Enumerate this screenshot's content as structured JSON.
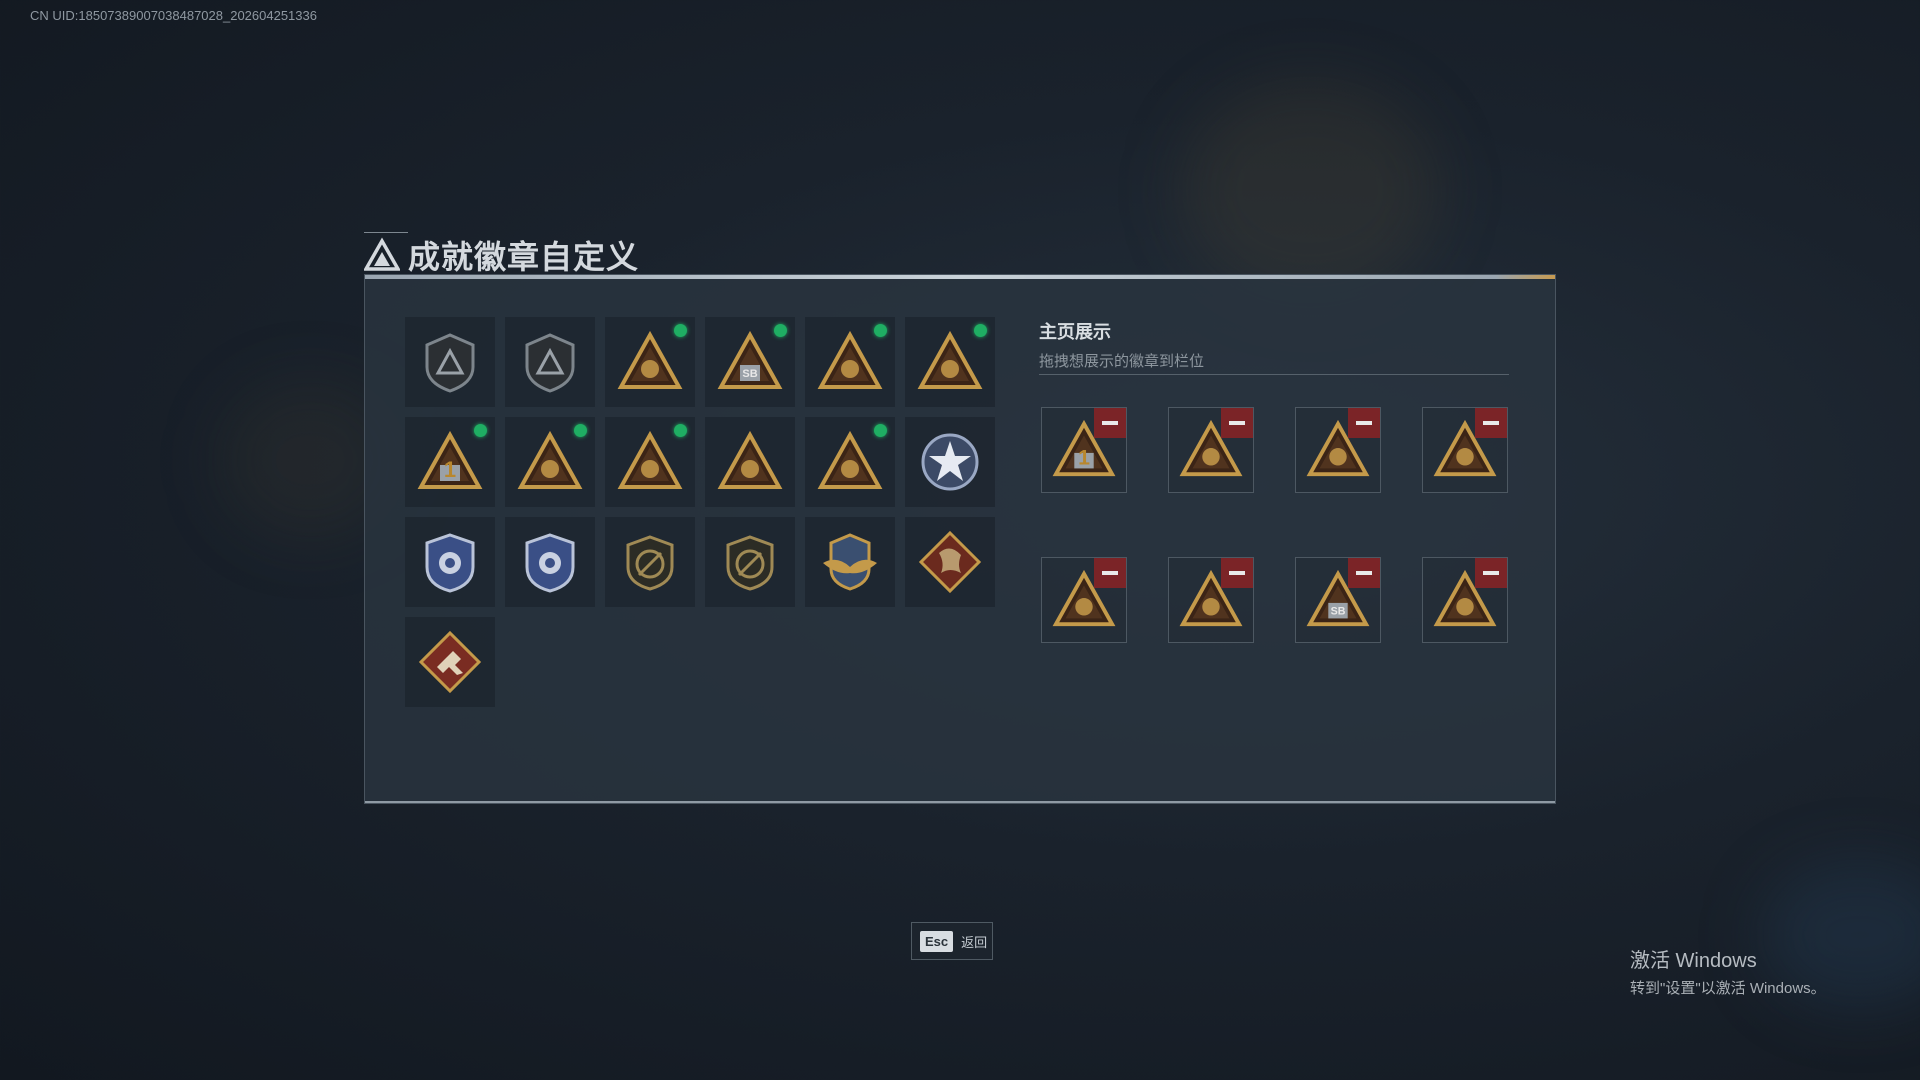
{
  "uid_text": "CN UID:1850738900703848​7028_202604251336",
  "title": "成就徽章自定义",
  "colors": {
    "gold": "#c49a4a",
    "badge_dark": "#3b2416",
    "new_dot": "#1fae63",
    "remove": "#7b2427"
  },
  "badges": [
    {
      "icon": "shield-triangle-emblem-icon",
      "style": "shield",
      "new": false
    },
    {
      "icon": "helicopter-shield-icon",
      "style": "shield",
      "new": false
    },
    {
      "icon": "supply-pack-triangle-icon",
      "style": "triangle",
      "new": true
    },
    {
      "icon": "sb-box-triangle-icon",
      "style": "triangle",
      "new": true,
      "glyph": "SB"
    },
    {
      "icon": "soldier-rifles-triangle-icon",
      "style": "triangle",
      "new": true
    },
    {
      "icon": "helmet-wings-triangle-icon",
      "style": "triangle",
      "new": true
    },
    {
      "icon": "number-one-triangle-icon",
      "style": "triangle",
      "new": true,
      "glyph": "1"
    },
    {
      "icon": "bullet-triangle-icon",
      "style": "triangle",
      "new": true
    },
    {
      "icon": "lion-wreath-triangle-icon",
      "style": "triangle",
      "new": true
    },
    {
      "icon": "operators-group-triangle-icon",
      "style": "triangle",
      "new": false
    },
    {
      "icon": "rocket-triangle-icon",
      "style": "triangle",
      "new": true
    },
    {
      "icon": "star-wreath-medal-icon",
      "style": "star",
      "new": false
    },
    {
      "icon": "blue-police-shield-icon",
      "style": "blue-shield",
      "new": false
    },
    {
      "icon": "blue-eagle-shield-icon",
      "style": "blue-shield",
      "new": false
    },
    {
      "icon": "rifle-crossed-shield-icon",
      "style": "dark-shield",
      "new": false
    },
    {
      "icon": "pistol-crossed-shield-icon",
      "style": "dark-shield",
      "new": false
    },
    {
      "icon": "gold-winged-crest-icon",
      "style": "crest",
      "new": false
    },
    {
      "icon": "dragon-diamond-icon",
      "style": "diamond",
      "new": false
    },
    {
      "icon": "runner-diamond-icon",
      "style": "diamond2",
      "new": false
    }
  ],
  "display": {
    "title": "主页展示",
    "subtitle": "拖拽想展示的徽章到栏位",
    "slots": [
      {
        "icon": "number-one-triangle-icon",
        "glyph": "1"
      },
      {
        "icon": "lion-wreath-triangle-icon"
      },
      {
        "icon": "bullet-triangle-icon"
      },
      {
        "icon": "soldier-rifles-triangle-icon"
      },
      {
        "icon": "supply-pack-triangle-icon"
      },
      {
        "icon": "helmet-wings-triangle-icon"
      },
      {
        "icon": "sb-box-triangle-icon",
        "glyph": "SB"
      },
      {
        "icon": "rocket-triangle-icon"
      }
    ]
  },
  "footer": {
    "esc_key": "Esc",
    "esc_label": "返回"
  },
  "watermark": {
    "line1": "激活 Windows",
    "line2": "转到\"设置\"以激活 Windows。"
  }
}
